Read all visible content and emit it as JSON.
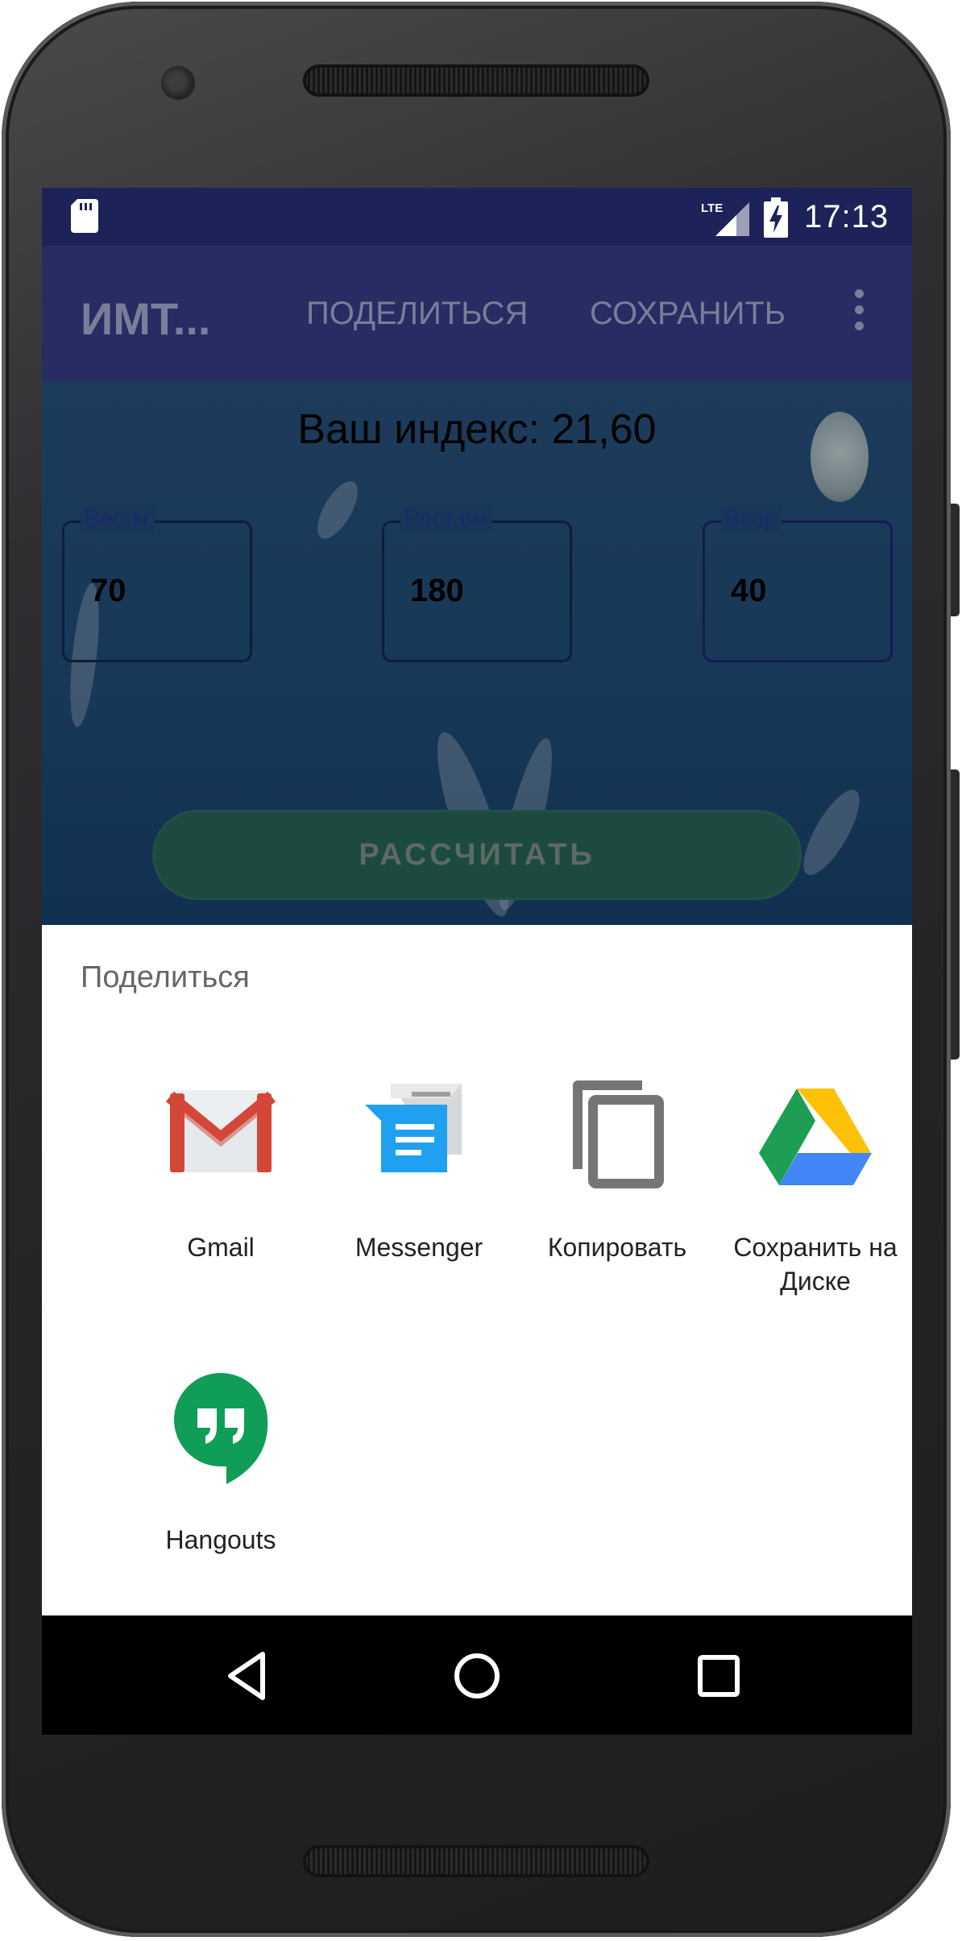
{
  "status_bar": {
    "time": "17:13",
    "network": "LTE"
  },
  "app_bar": {
    "title": "ИМТ...",
    "share_action": "ПОДЕЛИТЬСЯ",
    "save_action": "СОХРАНИТЬ"
  },
  "main": {
    "index_text": "Ваш индекс: 21,60",
    "fields": [
      {
        "label": "Вес,кг",
        "value": "70"
      },
      {
        "label": "Рост,см",
        "value": "180"
      },
      {
        "label": "Возр",
        "value": "40"
      }
    ],
    "calculate_label": "РАССЧИТАТЬ"
  },
  "share_sheet": {
    "title": "Поделиться",
    "targets": [
      {
        "label": "Gmail",
        "icon": "gmail-icon"
      },
      {
        "label": "Messenger",
        "icon": "messenger-icon"
      },
      {
        "label": "Копировать",
        "icon": "copy-icon"
      },
      {
        "label": "Сохранить на Диске",
        "icon": "google-drive-icon"
      },
      {
        "label": "Hangouts",
        "icon": "hangouts-icon"
      }
    ]
  },
  "colors": {
    "status_bar": "#1d2259",
    "app_bar_dimmed": "#272c63",
    "sheet_bg": "#ffffff",
    "nav_bar": "#000000"
  }
}
